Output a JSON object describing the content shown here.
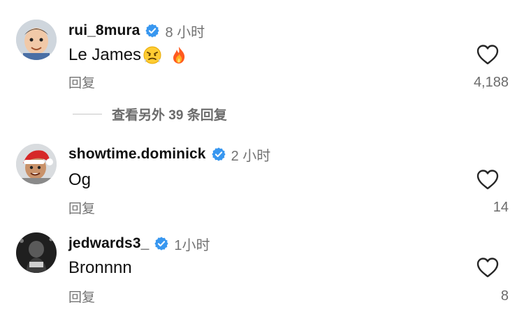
{
  "comments": [
    {
      "username": "rui_8mura",
      "time": "8 小时",
      "text": "Le James",
      "emojis": [
        "angry-face-emoji",
        "fire-emoji"
      ],
      "reply_label": "回复",
      "likes": "4,188",
      "verified": true
    },
    {
      "username": "showtime.dominick",
      "time": "2 小时",
      "text": "Og",
      "emojis": [],
      "reply_label": "回复",
      "likes": "14",
      "verified": true
    },
    {
      "username": "jedwards3_",
      "time": "1小时",
      "text": "Bronnnn",
      "emojis": [],
      "reply_label": "回复",
      "likes": "8",
      "verified": true
    }
  ],
  "view_replies": {
    "label": "查看另外 39 条回复"
  },
  "colors": {
    "verified_blue": "#3897f0",
    "secondary_text": "#737373",
    "heart_stroke": "#262626"
  },
  "icons": {
    "verified": "verified-badge-icon",
    "like": "heart-outline-icon"
  }
}
